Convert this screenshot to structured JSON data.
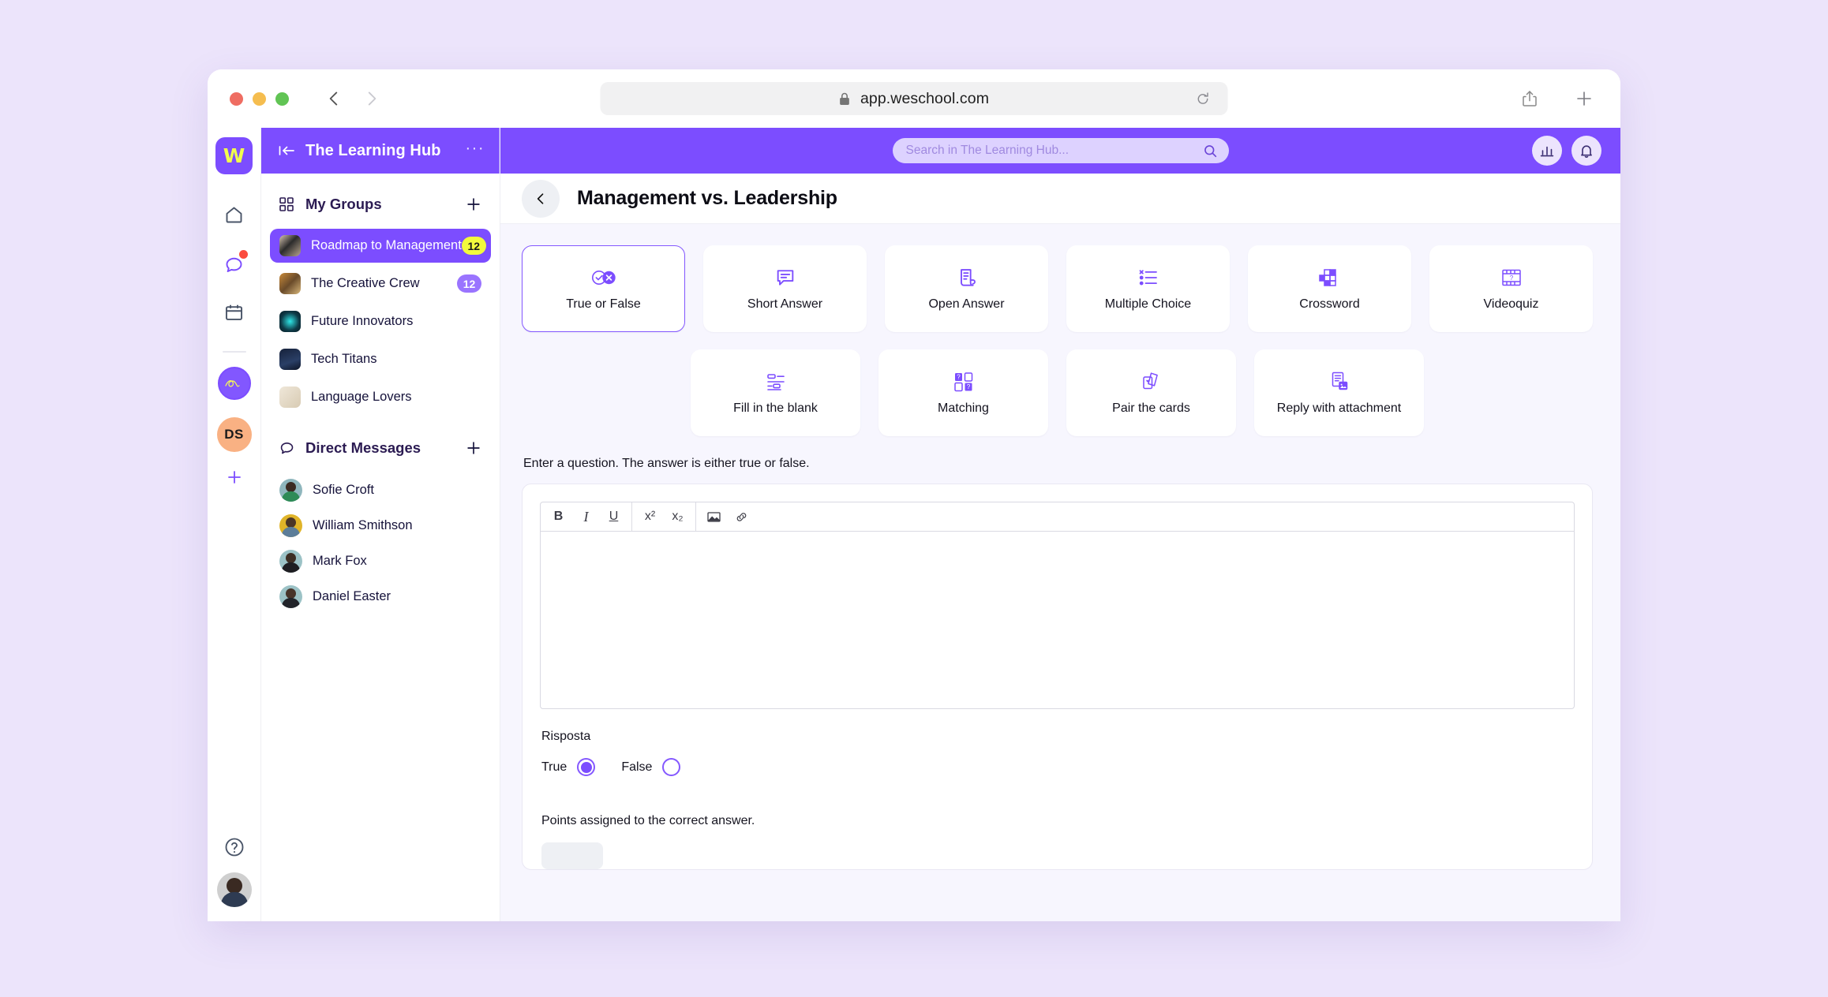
{
  "browser": {
    "url": "app.weschool.com",
    "lock_icon": "lock-icon",
    "reload_icon": "reload-icon",
    "back_icon": "chevron-left-icon",
    "forward_icon": "chevron-right-icon",
    "share_icon": "share-icon",
    "newtab_icon": "plus-icon"
  },
  "rail": {
    "logo_letter": "W",
    "items": [
      {
        "name": "home-icon",
        "label": "Home"
      },
      {
        "name": "chat-icon",
        "label": "Chat",
        "badge": true
      },
      {
        "name": "calendar-icon",
        "label": "Calendar"
      }
    ],
    "group_avatar": "group-avatar",
    "ds_initials": "DS",
    "add_label": "+",
    "help_icon": "help-icon",
    "profile_avatar": "profile-avatar"
  },
  "header": {
    "collapse_icon": "collapse-sidebar-icon",
    "hub_title": "The Learning Hub",
    "more_label": "···",
    "chart_icon": "chart-icon",
    "bell_icon": "bell-icon"
  },
  "search": {
    "placeholder": "Search in The Learning Hub...",
    "icon": "search-icon"
  },
  "sidebar": {
    "groups_section": {
      "title": "My Groups",
      "icon": "grid-icon",
      "add_label": "+",
      "items": [
        {
          "name": "Roadmap to Management",
          "badge": "12",
          "badge_style": "yellow",
          "active": true
        },
        {
          "name": "The Creative Crew",
          "badge": "12",
          "badge_style": "purple",
          "active": false
        },
        {
          "name": "Future Innovators",
          "badge": "",
          "badge_style": "",
          "active": false
        },
        {
          "name": "Tech Titans",
          "badge": "",
          "badge_style": "",
          "active": false
        },
        {
          "name": "Language Lovers",
          "badge": "",
          "badge_style": "",
          "active": false
        }
      ]
    },
    "dm_section": {
      "title": "Direct Messages",
      "icon": "speech-bubble-icon",
      "add_label": "+",
      "items": [
        {
          "name": "Sofie Croft"
        },
        {
          "name": "William Smithson"
        },
        {
          "name": "Mark Fox"
        },
        {
          "name": "Daniel Easter"
        }
      ]
    }
  },
  "main": {
    "back_icon": "chevron-left-icon",
    "title": "Management vs. Leadership",
    "question_types_row1": [
      {
        "label": "True or False",
        "icon": "true-false-icon",
        "selected": true
      },
      {
        "label": "Short Answer",
        "icon": "short-answer-icon",
        "selected": false
      },
      {
        "label": "Open Answer",
        "icon": "open-answer-icon",
        "selected": false
      },
      {
        "label": "Multiple Choice",
        "icon": "multiple-choice-icon",
        "selected": false
      },
      {
        "label": "Crossword",
        "icon": "crossword-icon",
        "selected": false
      },
      {
        "label": "Videoquiz",
        "icon": "videoquiz-icon",
        "selected": false
      }
    ],
    "question_types_row2": [
      {
        "label": "Fill in the blank",
        "icon": "fill-blank-icon",
        "selected": false
      },
      {
        "label": "Matching",
        "icon": "matching-icon",
        "selected": false
      },
      {
        "label": "Pair the cards",
        "icon": "pair-cards-icon",
        "selected": false
      },
      {
        "label": "Reply with attachment",
        "icon": "reply-attachment-icon",
        "selected": false
      }
    ],
    "hint": "Enter a question. The answer is either true or false.",
    "editor": {
      "value": "",
      "toolbar": [
        {
          "label": "B",
          "name": "bold-button"
        },
        {
          "label": "I",
          "name": "italic-button"
        },
        {
          "label": "U",
          "name": "underline-button"
        },
        {
          "label": "x²",
          "name": "superscript-button"
        },
        {
          "label": "x₂",
          "name": "subscript-button"
        },
        {
          "label": "image",
          "name": "insert-image-button"
        },
        {
          "label": "link",
          "name": "insert-link-button"
        }
      ]
    },
    "answer_label": "Risposta",
    "answer_options": [
      {
        "label": "True",
        "selected": true
      },
      {
        "label": "False",
        "selected": false
      }
    ],
    "points_label": "Points assigned to the correct answer."
  },
  "colors": {
    "brand_purple": "#7c4dff",
    "page_bg": "#ece4fb",
    "content_bg": "#f7f6fe",
    "badge_yellow": "#f2fa3c",
    "badge_purple": "#9a74ff"
  }
}
